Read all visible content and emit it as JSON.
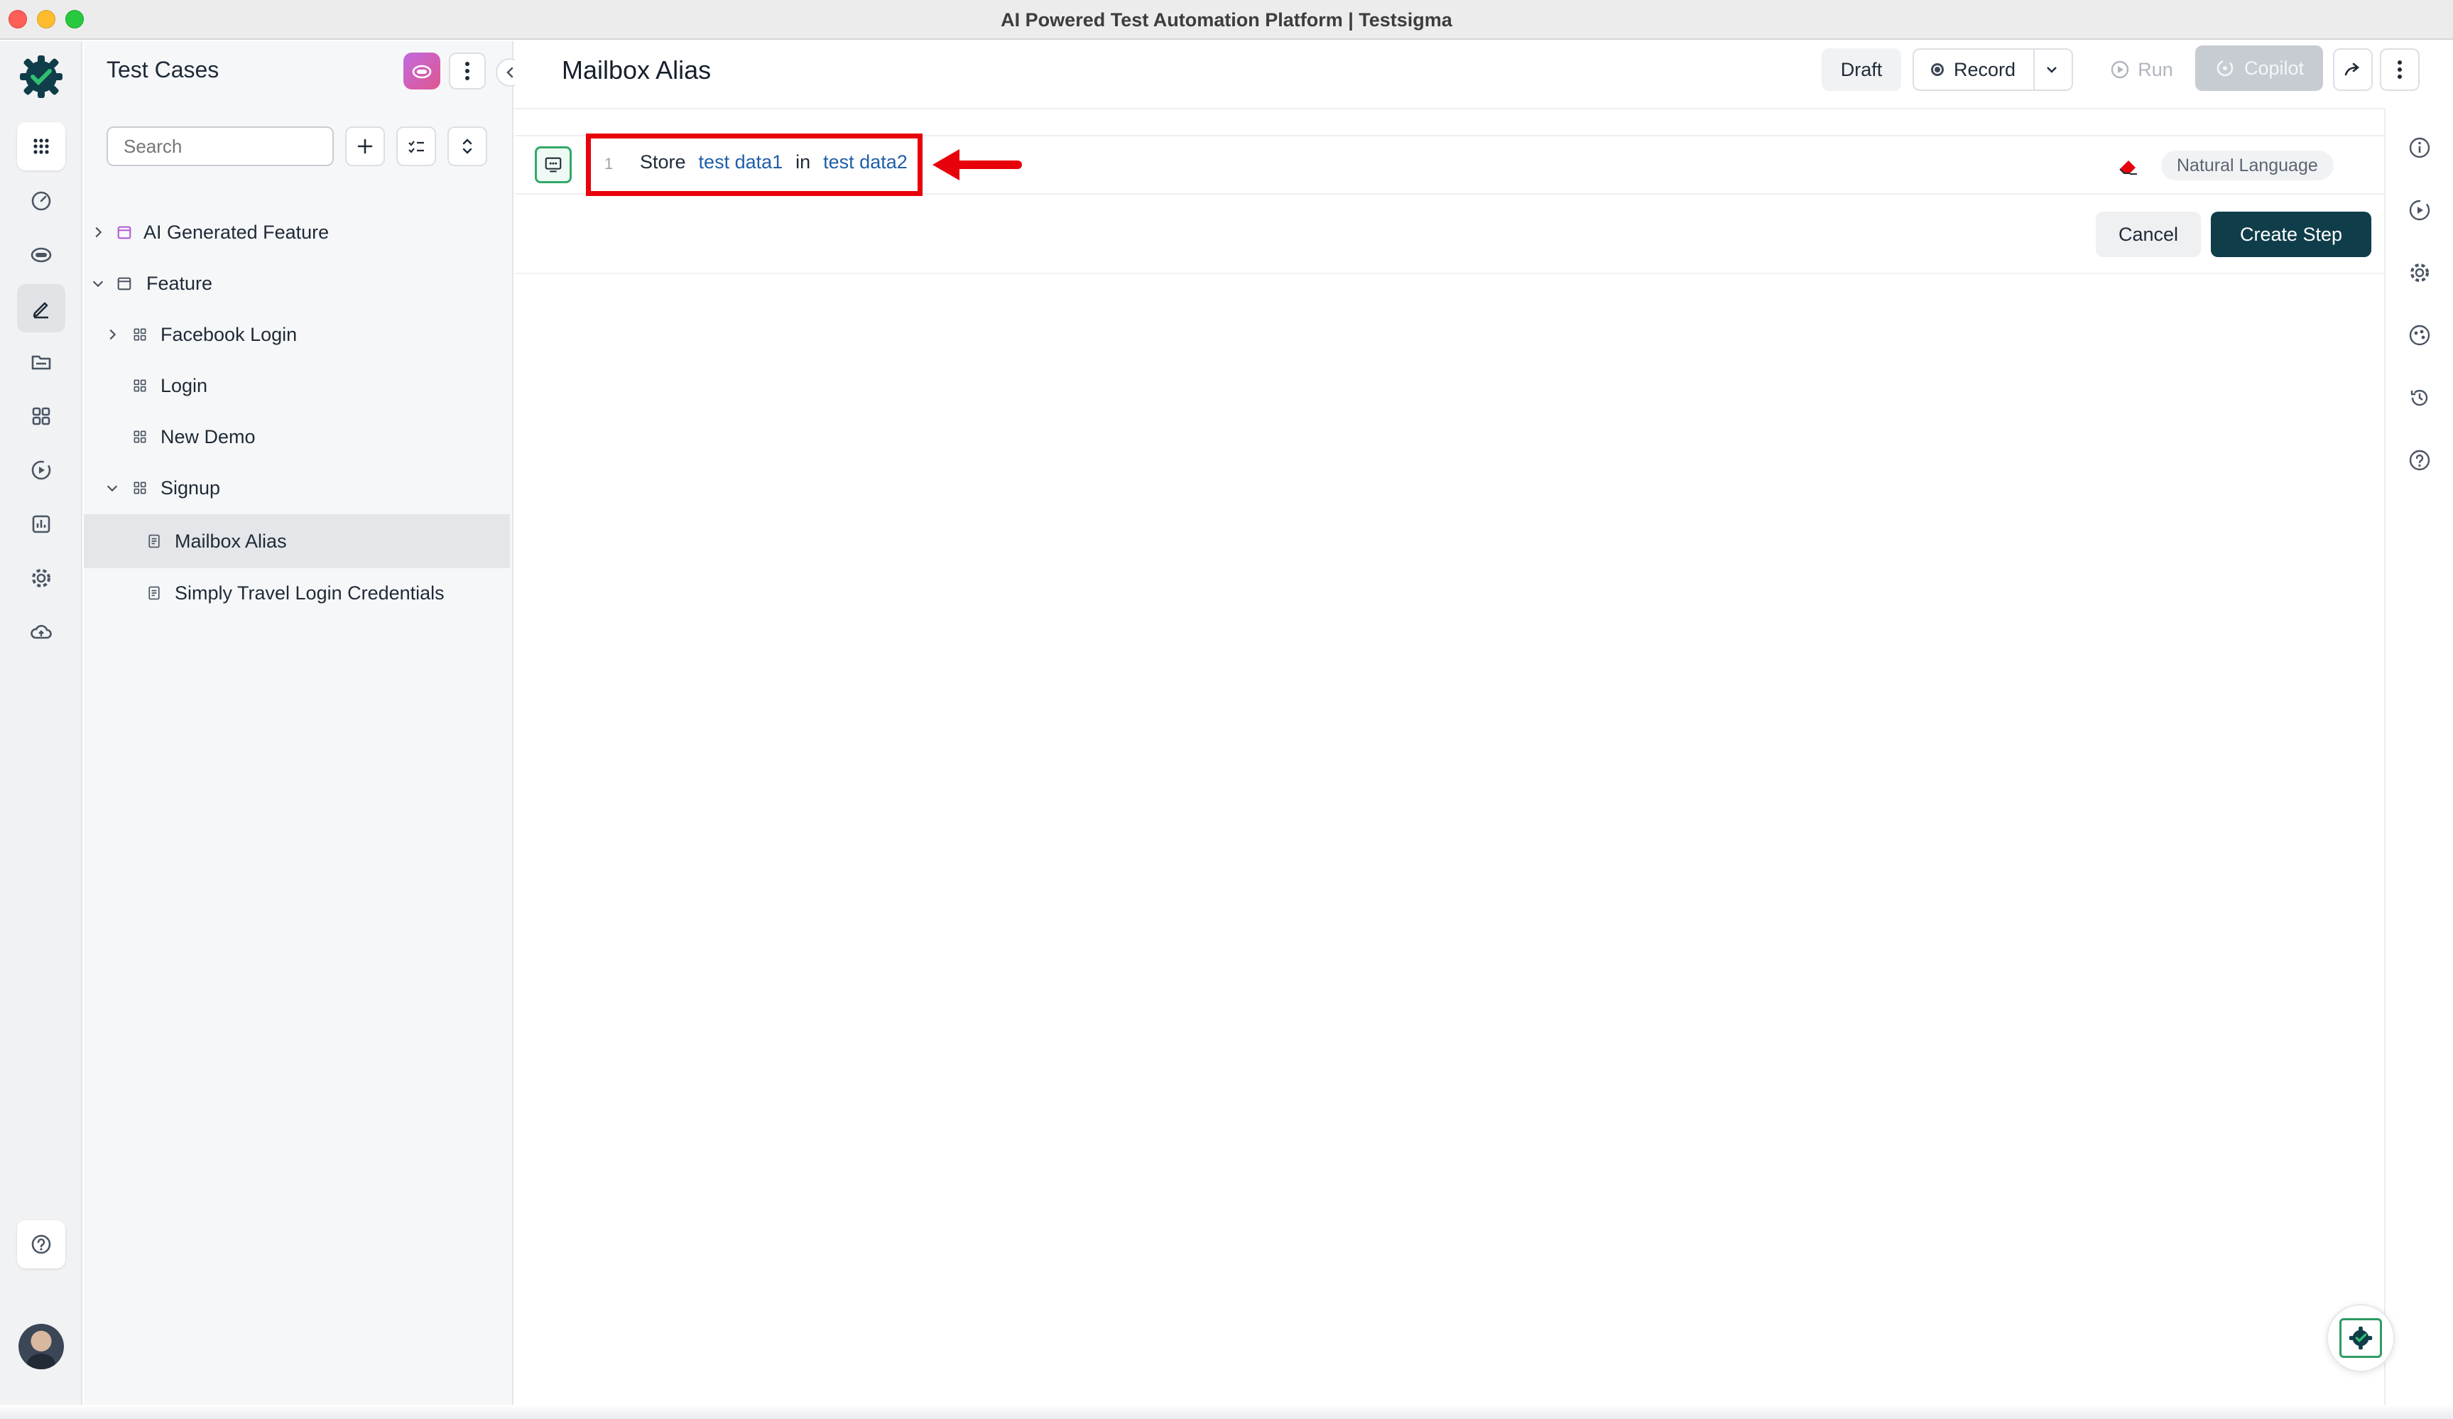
{
  "window": {
    "title": "AI Powered Test Automation Platform | Testsigma"
  },
  "panel": {
    "heading": "Test Cases",
    "search_placeholder": "Search",
    "tree": [
      {
        "label": "AI Generated Feature",
        "type": "feature",
        "expanded": false
      },
      {
        "label": "Feature",
        "type": "feature",
        "expanded": true
      },
      {
        "label": "Facebook Login",
        "type": "group",
        "expanded": false
      },
      {
        "label": "Login",
        "type": "group"
      },
      {
        "label": "New Demo",
        "type": "group"
      },
      {
        "label": "Signup",
        "type": "group",
        "expanded": true
      },
      {
        "label": "Mailbox Alias",
        "type": "testcase",
        "selected": true
      },
      {
        "label": "Simply Travel Login Credentials",
        "type": "testcase"
      }
    ]
  },
  "main": {
    "title": "Mailbox Alias",
    "toolbar": {
      "draft": "Draft",
      "record": "Record",
      "run": "Run",
      "copilot": "Copilot"
    },
    "step": {
      "number": "1",
      "keyword1": "Store",
      "data1": "test data1",
      "keyword2": "in",
      "data2": "test data2",
      "mode": "Natural Language"
    },
    "actions": {
      "cancel": "Cancel",
      "create": "Create Step"
    }
  },
  "colors": {
    "primary_dark": "#0f3d4a",
    "accent_green": "#34a86a",
    "annotation_red": "#e8000b",
    "test_data_blue": "#1f5fa8"
  }
}
